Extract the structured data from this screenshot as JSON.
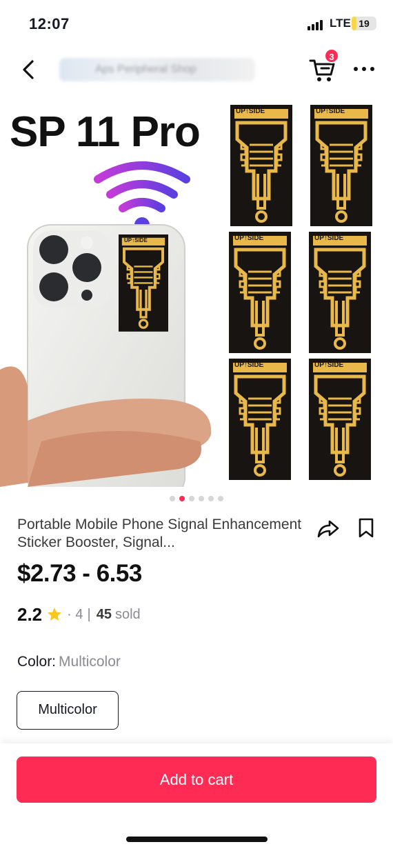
{
  "status_bar": {
    "time": "12:07",
    "network": "LTE",
    "battery": "19",
    "battery_level_percent": 19
  },
  "header": {
    "shop_name": "Aps Peripheral Shop",
    "cart_count": "3",
    "icons": {
      "back": "chevron-left-icon",
      "cart": "cart-icon",
      "more": "more-horizontal-icon"
    }
  },
  "gallery": {
    "image_title": "SP 11 Pro",
    "sticker_label": "UP↑SIDE",
    "dot_count": 6,
    "active_dot_index": 1
  },
  "product": {
    "title": "Portable Mobile Phone Signal Enhancement Sticker Booster, Signal...",
    "price": "$2.73 - 6.53",
    "rating": "2.2",
    "review_count": "· 4",
    "separator": "|",
    "sold_count": "45",
    "sold_label": "sold",
    "icons": {
      "share": "share-icon",
      "save": "bookmark-icon",
      "star": "star-icon"
    }
  },
  "variant": {
    "label": "Color:",
    "selected": "Multicolor",
    "options": [
      "Multicolor"
    ]
  },
  "actions": {
    "add_to_cart": "Add to cart"
  },
  "colors": {
    "accent": "#fe2c55",
    "star": "#f9c81e",
    "gold_trace": "#e8b84a"
  }
}
